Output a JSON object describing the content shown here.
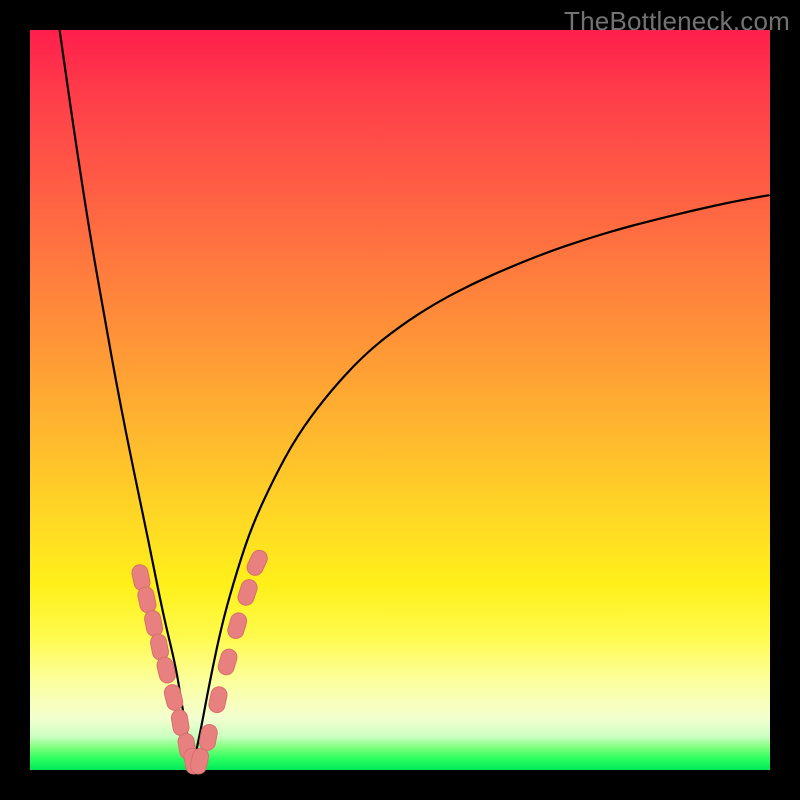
{
  "watermark": "TheBottleneck.com",
  "colors": {
    "background": "#000000",
    "gradient_top": "#ff1f4c",
    "gradient_mid": "#ffd824",
    "gradient_bottom": "#00e85a",
    "curve": "#000000",
    "marker_fill": "#e98080",
    "marker_stroke": "#d86f6f"
  },
  "chart_data": {
    "type": "line",
    "title": "",
    "xlabel": "",
    "ylabel": "",
    "xlim": [
      0,
      100
    ],
    "ylim": [
      0,
      100
    ],
    "grid": false,
    "legend": false,
    "note": "V-shaped bottleneck curve; y expressed as percent of plot height from bottom. Minimum ≈0 near x≈22. Left arm rises steeply to 100 at x≈4; right arm rises with diminishing slope toward ≈78 at x=100.",
    "series": [
      {
        "name": "left-arm",
        "x": [
          4,
          6,
          8,
          10,
          12,
          14,
          16,
          18,
          19.7,
          20.5,
          21.2,
          22
        ],
        "y": [
          100,
          86,
          73,
          61.5,
          50.5,
          40.5,
          31,
          21,
          14,
          9,
          5,
          0.5
        ]
      },
      {
        "name": "right-arm",
        "x": [
          22,
          23,
          24.3,
          26,
          28,
          30,
          33,
          36,
          40,
          45,
          50,
          55,
          60,
          65,
          70,
          75,
          80,
          85,
          90,
          95,
          100
        ],
        "y": [
          0.5,
          5,
          12,
          20,
          27,
          33,
          39.5,
          45,
          50.5,
          56,
          60,
          63.2,
          65.8,
          68,
          70,
          71.7,
          73.2,
          74.5,
          75.7,
          76.8,
          77.7
        ]
      }
    ],
    "markers": {
      "name": "highlighted-segments",
      "shape": "rounded-capsule",
      "color": "#e98080",
      "points_xy_percent": [
        [
          15.0,
          26.0
        ],
        [
          15.8,
          23.0
        ],
        [
          16.7,
          19.8
        ],
        [
          17.5,
          16.6
        ],
        [
          18.4,
          13.5
        ],
        [
          19.4,
          9.8
        ],
        [
          20.3,
          6.4
        ],
        [
          21.2,
          3.2
        ],
        [
          22.0,
          1.2
        ],
        [
          22.9,
          1.2
        ],
        [
          24.1,
          4.4
        ],
        [
          25.4,
          9.5
        ],
        [
          26.7,
          14.6
        ],
        [
          28.0,
          19.5
        ],
        [
          29.4,
          24.0
        ],
        [
          30.7,
          28.0
        ]
      ]
    }
  }
}
